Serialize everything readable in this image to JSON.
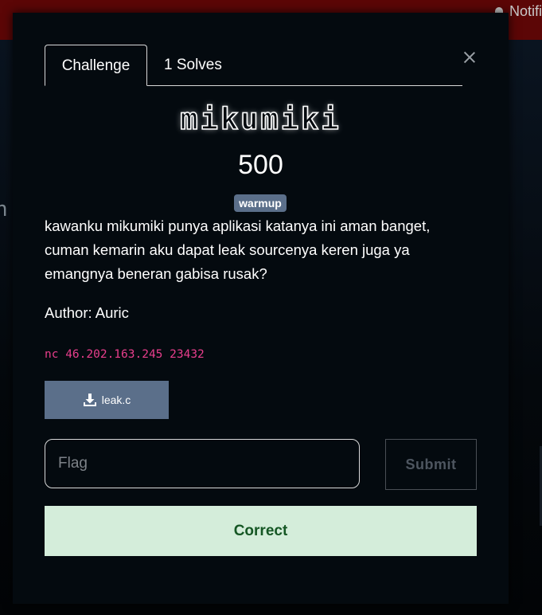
{
  "topbar": {
    "notifications_label": "Notifi"
  },
  "background": {
    "partial_letter": "n"
  },
  "modal": {
    "tabs": [
      {
        "label": "Challenge"
      },
      {
        "label": "1 Solves"
      }
    ],
    "challenge": {
      "name": "mikumiki",
      "value": "500",
      "category_badge": "warmup",
      "description_lines": [
        "kawanku mikumiki punya aplikasi katanya ini aman banget,",
        "cuman kemarin aku dapat leak sourcenya keren juga ya",
        "emangnya beneran gabisa rusak?"
      ],
      "author": "Author: Auric",
      "connection": "nc 46.202.163.245 23432",
      "file": {
        "label": "leak.c",
        "icon": "download-icon"
      }
    },
    "flag_input": {
      "placeholder": "Flag",
      "value": ""
    },
    "submit_label": "Submit",
    "result": {
      "text": "Correct",
      "status_color": "#d4edda"
    }
  }
}
